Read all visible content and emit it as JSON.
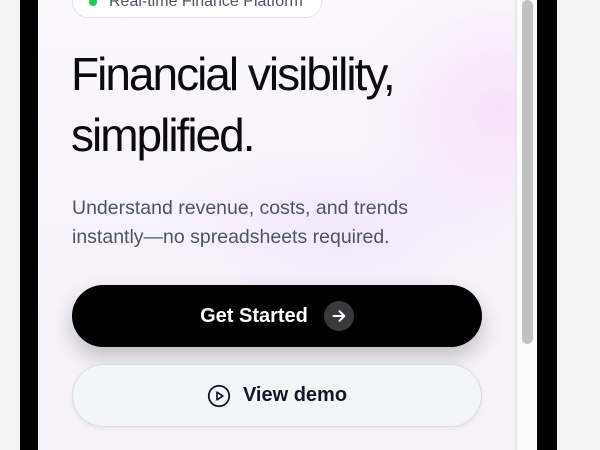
{
  "badge": {
    "label": "Real-time Finance Platform",
    "dot_color": "#22c55e"
  },
  "hero": {
    "headline_line1": "Financial visibility,",
    "headline_line2": "simplified.",
    "subtitle_line1": "Understand revenue, costs, and trends",
    "subtitle_line2": "instantly—no spreadsheets required."
  },
  "actions": {
    "primary_label": "Get Started",
    "primary_icon": "arrow-right-icon",
    "secondary_label": "View demo",
    "secondary_icon": "play-circle-icon"
  },
  "colors": {
    "primary_button": "#000000",
    "accent_status": "#22c55e"
  }
}
